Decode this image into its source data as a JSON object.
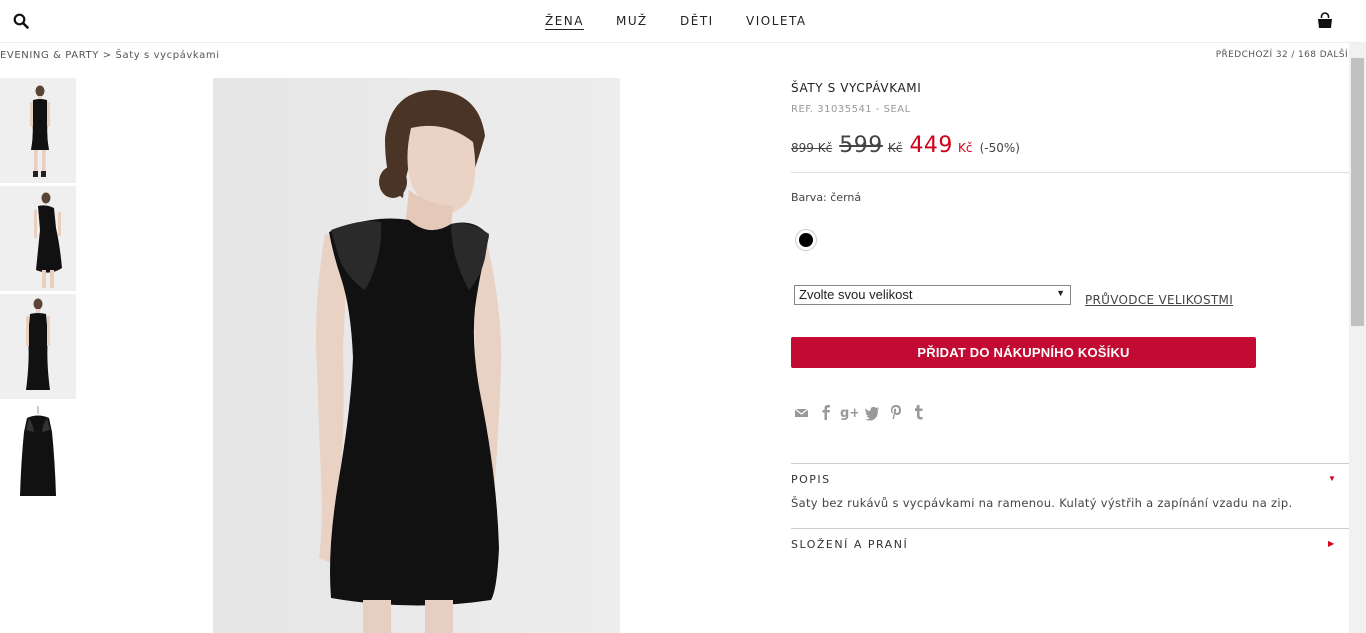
{
  "header": {
    "nav": [
      "ŽENA",
      "MUŽ",
      "DĚTI",
      "VIOLETA"
    ],
    "active_nav": "ŽENA"
  },
  "breadcrumb": {
    "parent": "EVENING & PARTY",
    "separator": ">",
    "current": "Šaty s vycpávkami"
  },
  "pager": {
    "prev": "PŘEDCHOZÍ",
    "position": "32 / 168",
    "next": "DALŠÍ"
  },
  "product": {
    "title": "ŠATY S VYCPÁVKAMI",
    "ref": "REF. 31035541 - SEAL",
    "price_original": "899 Kč",
    "price_previous": "599",
    "price_previous_currency": "Kč",
    "price_current": "449",
    "price_current_currency": "Kč",
    "discount": "(-50%)",
    "color_label": "Barva: černá",
    "swatch_color": "#000000",
    "size_select": {
      "value": "Zvolte svou velikost"
    },
    "size_guide": "PRŮVODCE VELIKOSTMI",
    "add_to_cart": "PŘIDAT DO NÁKUPNÍHO KOŠÍKU",
    "share_icons": [
      "mail-icon",
      "facebook-icon",
      "google-plus-icon",
      "twitter-icon",
      "pinterest-icon",
      "tumblr-icon"
    ],
    "description_title": "POPIS",
    "description": "Šaty bez rukávů s vycpávkami na ramenou. Kulatý výstřih a zapínání vzadu na zip.",
    "composition_title": "SLOŽENÍ A PRANÍ"
  },
  "colors": {
    "accent": "#c20a33",
    "sale_price": "#d0021b"
  }
}
